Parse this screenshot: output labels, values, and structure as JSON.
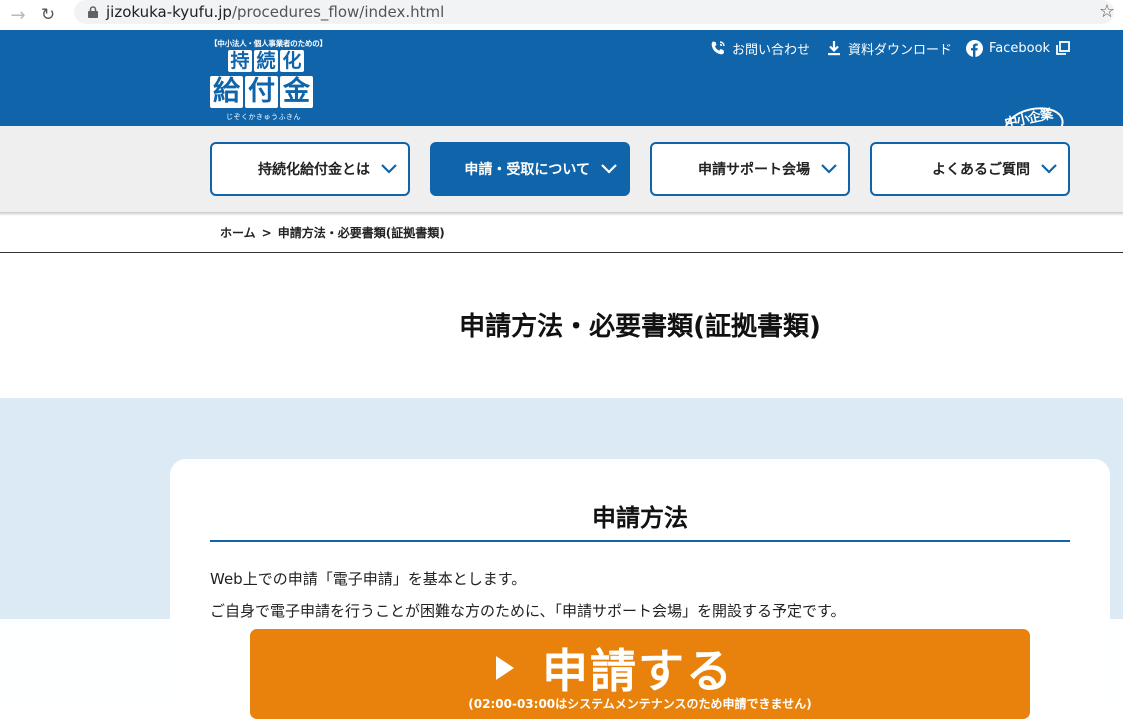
{
  "browser": {
    "url_host": "jizokuka-kyufu.jp",
    "url_path": "/procedures_flow/index.html",
    "back_icon": "arrow-right-icon",
    "reload_icon": "reload-icon",
    "lock_icon": "lock-icon",
    "star_icon": "star-icon"
  },
  "header": {
    "background": "#0f64aa",
    "logo": {
      "tagline": "【中小法人・個人事業者のための】",
      "row1": [
        "持",
        "続",
        "化"
      ],
      "row2": [
        "給",
        "付",
        "金"
      ],
      "kana": "じぞくかきゅうふきん"
    },
    "utility": {
      "contact_label": "お問い合わせ",
      "download_label": "資料ダウンロード",
      "facebook_label": "Facebook"
    },
    "agency_logo": "中小企業庁"
  },
  "nav": {
    "items": [
      {
        "label": "持続化給付金とは",
        "active": false
      },
      {
        "label": "申請・受取について",
        "active": true
      },
      {
        "label": "申請サポート会場",
        "active": false
      },
      {
        "label": "よくあるご質問",
        "active": false
      }
    ]
  },
  "breadcrumb": {
    "home": "ホーム",
    "separator": ">",
    "current": "申請方法・必要書類(証拠書類)"
  },
  "page": {
    "title": "申請方法・必要書類(証拠書類)"
  },
  "section": {
    "title": "申請方法",
    "paragraphs": [
      "Web上での申請「電子申請」を基本とします。",
      "ご自身で電子申請を行うことが困難な方のために、「申請サポート会場」を開設する予定です。"
    ]
  },
  "cta": {
    "label": "申請する",
    "note": "(02:00-03:00はシステムメンテナンスのため申請できません)",
    "color": "#e8820c"
  }
}
